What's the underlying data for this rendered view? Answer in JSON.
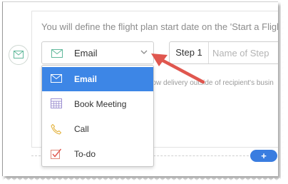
{
  "instruction_text": "You will define the flight plan start date on the 'Start a Flight' sc",
  "step_type_select": {
    "selected": "Email"
  },
  "step": {
    "number_label": "Step 1",
    "name_placeholder": "Name of Step"
  },
  "hint_text": "llow delivery outside of recipient's busin",
  "add_button_label": "+",
  "dropdown": {
    "items": [
      {
        "label": "Email",
        "icon": "envelope-icon",
        "active": true
      },
      {
        "label": "Book Meeting",
        "icon": "calendar-icon",
        "active": false
      },
      {
        "label": "Call",
        "icon": "phone-icon",
        "active": false
      },
      {
        "label": "To-do",
        "icon": "checkbox-icon",
        "active": false
      }
    ]
  },
  "colors": {
    "accent": "#3d86e6",
    "annotation_arrow": "#e0574f",
    "icon_green": "#5fb89a"
  }
}
